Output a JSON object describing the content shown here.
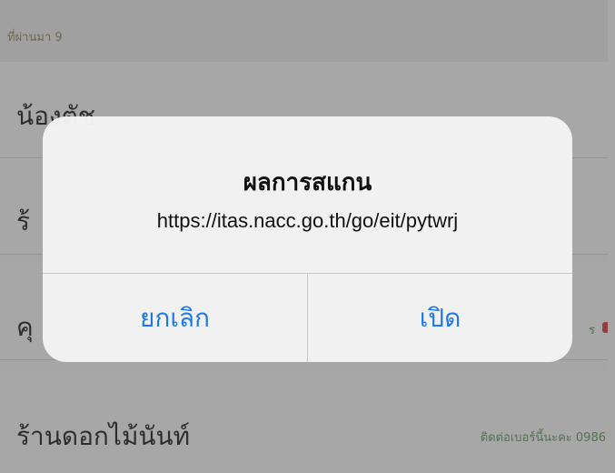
{
  "background": {
    "header_text": "ที่ผ่านมา 9",
    "rows": [
      {
        "title": "น้องตัช",
        "subtitle": ""
      },
      {
        "title": "ร้",
        "subtitle": ""
      },
      {
        "title": "คุ",
        "subtitle": "ร"
      },
      {
        "title": "ร้านดอกไม้นันท์",
        "subtitle": "ติดต่อเบอร์นี้นะคะ 0986"
      }
    ]
  },
  "alert": {
    "title": "ผลการสแกน",
    "message": "https://itas.nacc.go.th/go/eit/pytwrj",
    "buttons": {
      "cancel": "ยกเลิก",
      "open": "เปิด"
    }
  },
  "colors": {
    "button_text": "#1f7ae8",
    "overlay": "rgba(60,60,60,0.45)"
  }
}
